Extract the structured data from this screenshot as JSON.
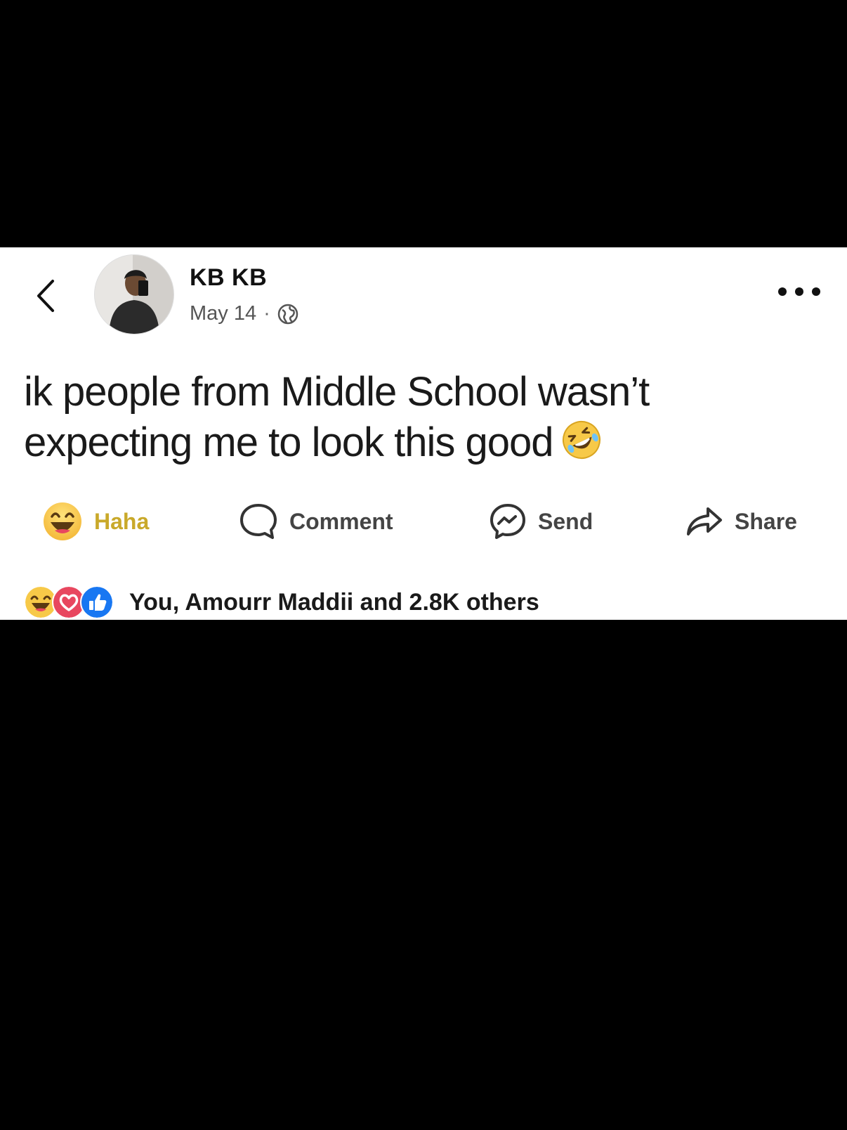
{
  "header": {
    "back_icon": "chevron-left-icon",
    "author_name": "KB KB",
    "date": "May 14",
    "separator": "·",
    "privacy_icon": "globe-icon",
    "more_icon": "more-horizontal-icon"
  },
  "post": {
    "text": "ik people from Middle School wasn’t expecting me to look this good",
    "emoji": "rolling-on-floor-laughing-icon"
  },
  "actions": {
    "haha_label": "Haha",
    "comment_label": "Comment",
    "send_label": "Send",
    "share_label": "Share"
  },
  "reactions": {
    "icons": [
      "haha-icon",
      "love-icon",
      "like-icon"
    ],
    "summary": "You, Amourr Maddii and 2.8K others"
  },
  "colors": {
    "background": "#000000",
    "card": "#ffffff",
    "haha_yellow": "#f7c948",
    "haha_label": "#c9a92a",
    "love_red": "#e8475f",
    "like_blue": "#1877f2"
  }
}
